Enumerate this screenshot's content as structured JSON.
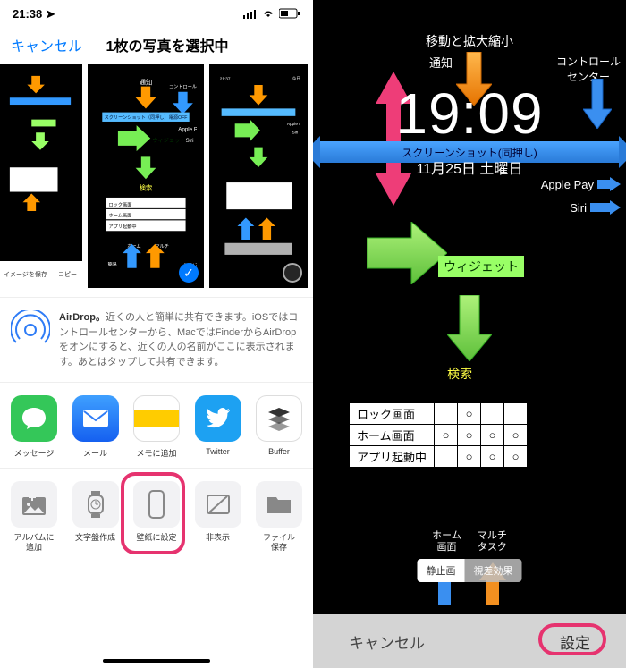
{
  "statusbar": {
    "time": "21:38",
    "loc_icon": "location-icon",
    "signal": "signal-icon",
    "wifi": "wifi-icon",
    "battery": "battery-icon"
  },
  "header": {
    "cancel": "キャンセル",
    "title": "1枚の写真を選択中"
  },
  "thumbs": {
    "t0": {
      "save": "イメージを保存",
      "copy": "コピー"
    },
    "t1": {
      "checked": true
    },
    "t2": {
      "checked": false
    }
  },
  "airdrop": {
    "label": "AirDrop。",
    "text": "近くの人と簡単に共有できます。iOSではコントロールセンターから、MacではFinderからAirDropをオンにすると、近くの人の名前がここに表示されます。あとはタップして共有できます。"
  },
  "apps": [
    {
      "name": "message-app",
      "label": "メッセージ",
      "bg": "#34c759",
      "glyph": "message"
    },
    {
      "name": "mail-app",
      "label": "メール",
      "bg": "#2f7cf6",
      "glyph": "mail"
    },
    {
      "name": "notes-app",
      "label": "メモに追加",
      "bg": "#fff",
      "glyph": "notes"
    },
    {
      "name": "twitter-app",
      "label": "Twitter",
      "bg": "#1da1f2",
      "glyph": "twitter"
    },
    {
      "name": "buffer-app",
      "label": "Buffer",
      "bg": "#fff",
      "glyph": "buffer"
    }
  ],
  "actions": [
    {
      "name": "add-to-album",
      "label": "アルバムに\n追加",
      "glyph": "album"
    },
    {
      "name": "create-watchface",
      "label": "文字盤作成",
      "glyph": "watch"
    },
    {
      "name": "set-wallpaper",
      "label": "壁紙に設定",
      "glyph": "phone"
    },
    {
      "name": "hide",
      "label": "非表示",
      "glyph": "hide"
    },
    {
      "name": "save-file",
      "label": "ファイル\n保存",
      "glyph": "folder"
    }
  ],
  "right": {
    "caption": "移動と拡大縮小",
    "notify": "通知",
    "control_center": "コントロール\nセンター",
    "time": "19:09",
    "date": "11月25日 土曜日",
    "screenshot": "スクリーンショット(同押し)",
    "applepay": "Apple Pay",
    "siri": "Siri",
    "widget": "ウィジェット",
    "search": "検索",
    "table": {
      "rows": [
        "ロック画面",
        "ホーム画面",
        "アプリ起動中"
      ],
      "grid": [
        [
          "",
          "○",
          "",
          ""
        ],
        [
          "○",
          "○",
          "○",
          "○"
        ],
        [
          "",
          "○",
          "○",
          "○"
        ]
      ]
    },
    "home": "ホーム\n画面",
    "multi": "マルチ\nタスク",
    "pills": {
      "still": "静止画",
      "perspective": "視差効果"
    },
    "cancel": "キャンセル",
    "set": "設定"
  }
}
